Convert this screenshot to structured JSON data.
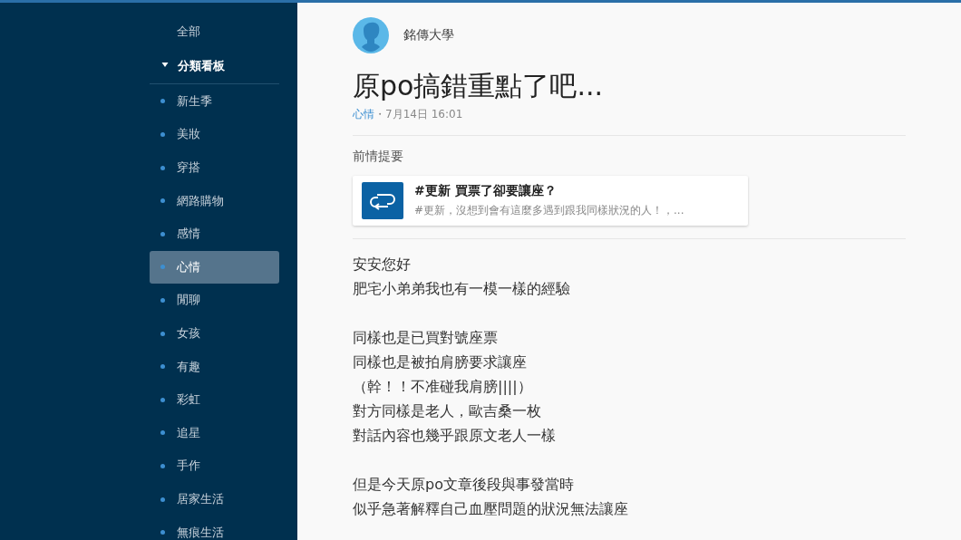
{
  "sidebar": {
    "top_item": {
      "label": "全部",
      "selected": false
    },
    "section": {
      "label": "分類看板",
      "expanded": true
    },
    "items": [
      {
        "label": "新生季",
        "selected": false
      },
      {
        "label": "美妝",
        "selected": false
      },
      {
        "label": "穿搭",
        "selected": false
      },
      {
        "label": "網路購物",
        "selected": false
      },
      {
        "label": "感情",
        "selected": false
      },
      {
        "label": "心情",
        "selected": true
      },
      {
        "label": "閒聊",
        "selected": false
      },
      {
        "label": "女孩",
        "selected": false
      },
      {
        "label": "有趣",
        "selected": false
      },
      {
        "label": "彩虹",
        "selected": false
      },
      {
        "label": "追星",
        "selected": false
      },
      {
        "label": "手作",
        "selected": false
      },
      {
        "label": "居家生活",
        "selected": false
      },
      {
        "label": "無痕生活",
        "selected": false
      }
    ]
  },
  "post": {
    "author": "銘傳大學",
    "title": "原po搞錯重點了吧...",
    "board": "心情",
    "date": "・7月14日 16:01",
    "previous": {
      "heading": "前情提要",
      "card_title": "#更新 買票了卻要讓座？",
      "card_excerpt": "#更新，沒想到會有這麼多遇到跟我同樣狀況的人！，..."
    },
    "paragraphs": [
      [
        "安安您好",
        "肥宅小弟弟我也有一模一樣的經驗"
      ],
      [
        "同樣也是已買對號座票",
        "同樣也是被拍肩膀要求讓座",
        "（幹！！不准碰我肩膀||||）",
        "對方同樣是老人，歐吉桑一枚",
        "對話內容也幾乎跟原文老人一樣"
      ],
      [
        "但是今天原po文章後段與事發當時",
        "似乎急著解釋自己血壓問題的狀況無法讓座"
      ]
    ]
  }
}
